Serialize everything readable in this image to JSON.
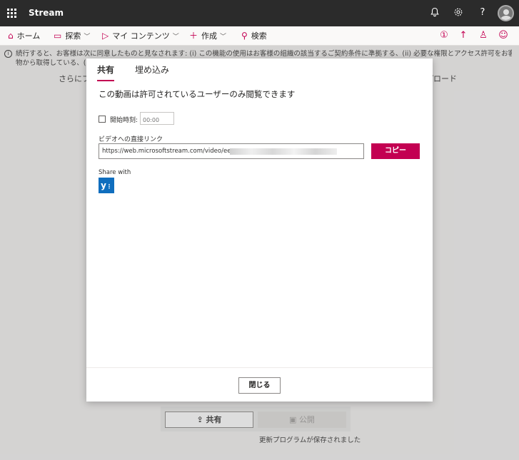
{
  "app": {
    "title": "Stream"
  },
  "topbar": {
    "icons": [
      "bell-icon",
      "gear-icon",
      "help-icon",
      "avatar"
    ]
  },
  "nav": {
    "home": "ホーム",
    "explore": "探索",
    "my_content": "マイ コンテンツ",
    "create": "作成",
    "search": "検索"
  },
  "notice": {
    "line1": "続行すると、お客様は次に同意したものと見なされます: (i) この機能の使用はお客様の組織の該当するご契約条件に準拠する、(ii) 必要な権限とアクセス許可をお客様がビデオの内の人",
    "line2": "物から取得している、(iii)"
  },
  "background": {
    "left_text": "さらにフ",
    "right_text": "プロード",
    "share_button": "共有",
    "publish_button": "公開",
    "saved_text": "更新プログラムが保存されました"
  },
  "dialog": {
    "tabs": [
      "共有",
      "埋め込み"
    ],
    "description": "この動画は許可されているユーザーのみ閲覧できます",
    "start_time_label": "開始時刻:",
    "start_time_placeholder": "00:00",
    "link_label": "ビデオへの直接リンク",
    "link_value": "https://web.microsoftstream.com/video/ee",
    "copy_button": "コピー",
    "share_with_label": "Share with",
    "yammer_label": "y",
    "close_button": "閉じる"
  },
  "colors": {
    "accent": "#c30052",
    "topbar": "#2b2b2b",
    "yammer": "#106ebe"
  }
}
